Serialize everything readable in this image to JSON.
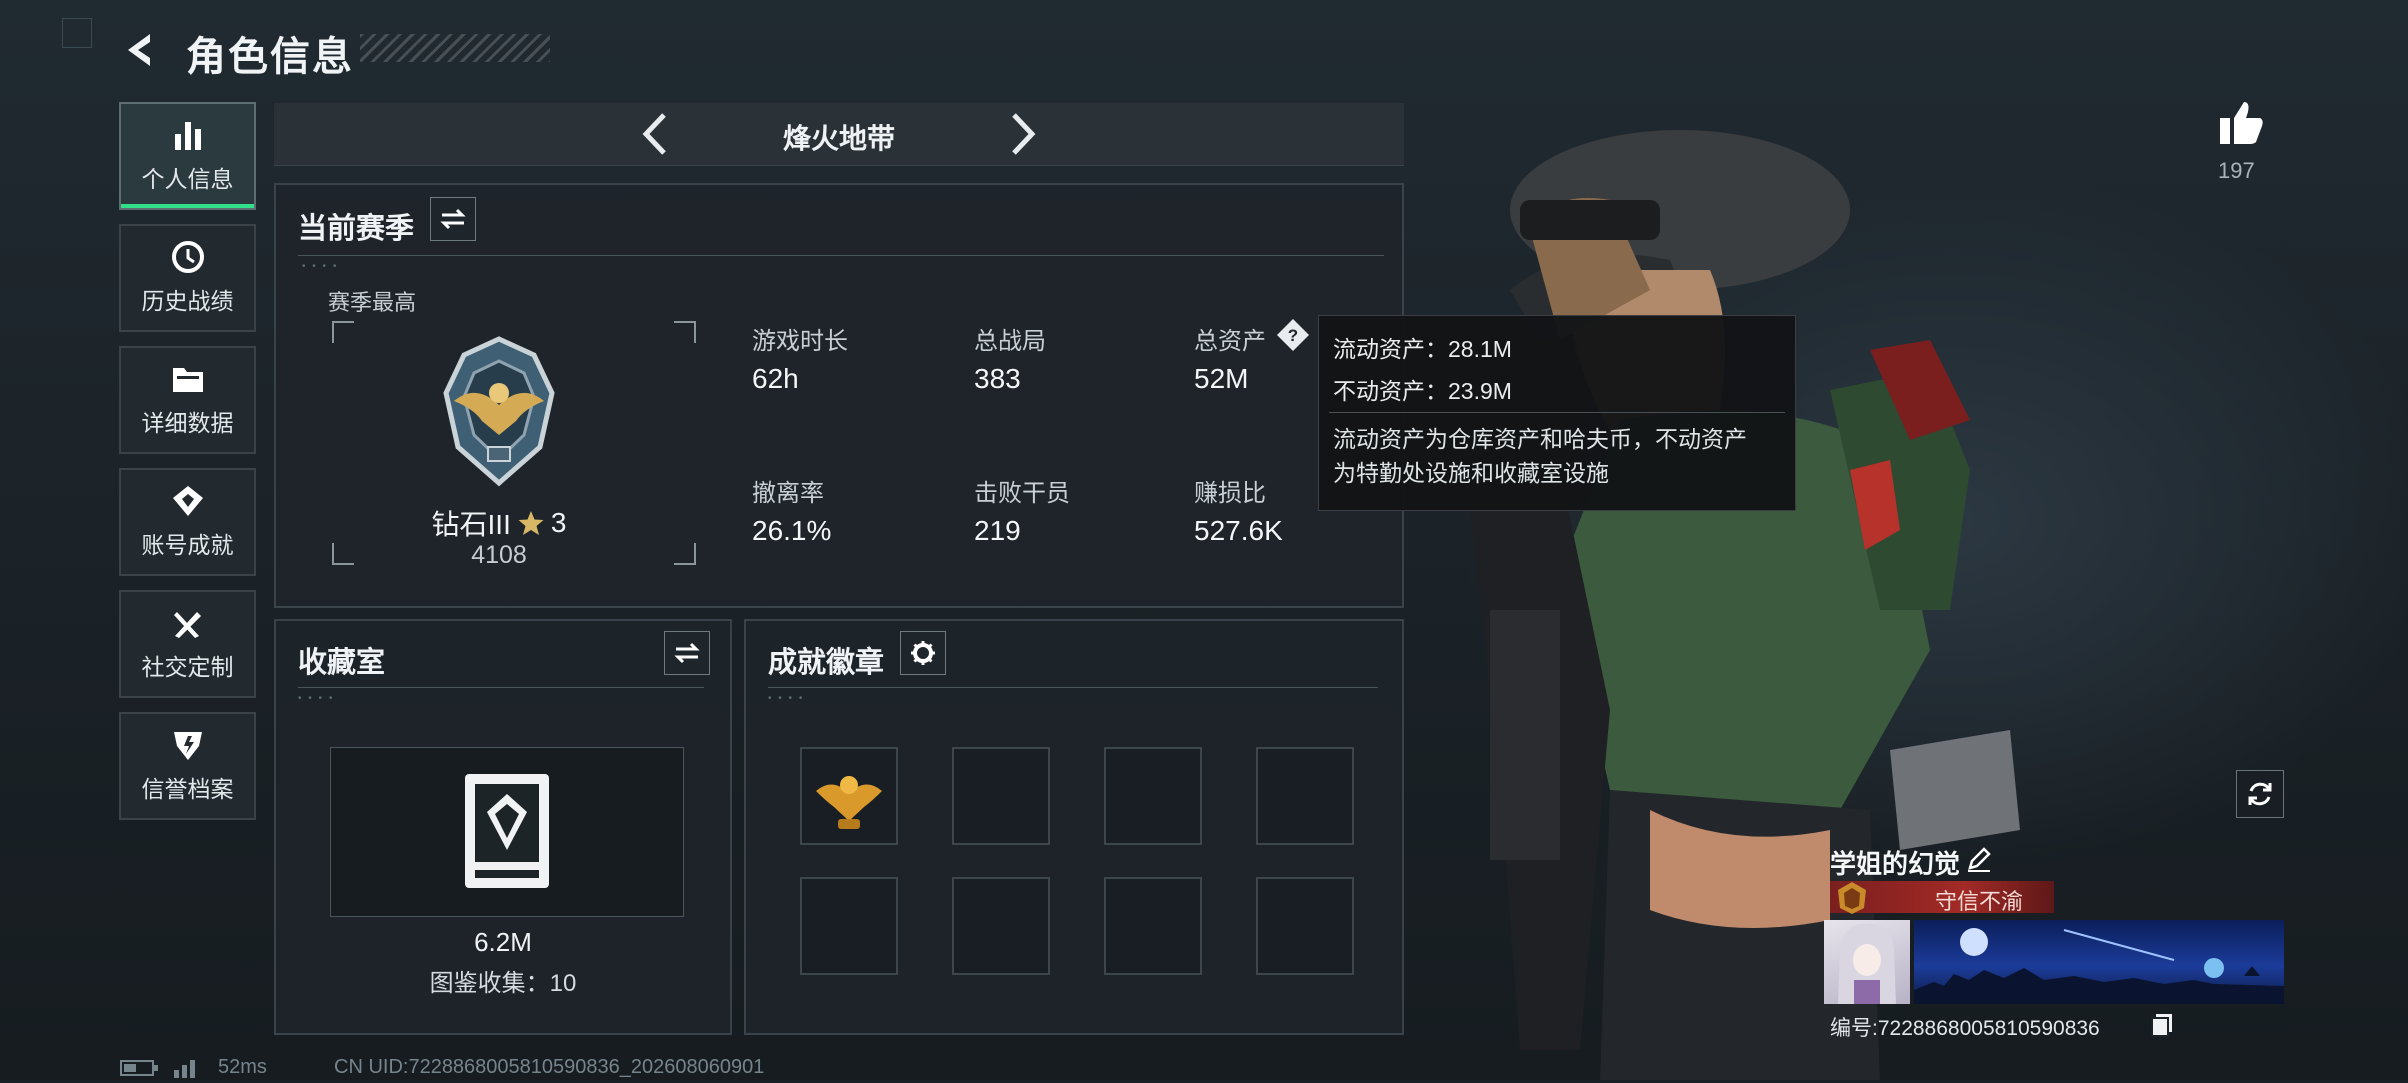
{
  "header": {
    "title": "角色信息"
  },
  "sidebar": {
    "items": [
      {
        "label": "个人信息",
        "icon": "bar-chart-icon",
        "active": true
      },
      {
        "label": "历史战绩",
        "icon": "clock-icon",
        "active": false
      },
      {
        "label": "详细数据",
        "icon": "folder-icon",
        "active": false
      },
      {
        "label": "账号成就",
        "icon": "achievement-icon",
        "active": false
      },
      {
        "label": "社交定制",
        "icon": "tools-icon",
        "active": false
      },
      {
        "label": "信誉档案",
        "icon": "shield-icon",
        "active": false
      }
    ]
  },
  "mode_nav": {
    "title": "烽火地带"
  },
  "season": {
    "title": "当前赛季",
    "best_label": "赛季最高",
    "rank_name": "钻石III",
    "rank_stars": "3",
    "rank_points": "4108",
    "stats": [
      {
        "label": "游戏时长",
        "value": "62h"
      },
      {
        "label": "总战局",
        "value": "383"
      },
      {
        "label": "总资产",
        "value": "52M"
      },
      {
        "label": "撤离率",
        "value": "26.1%"
      },
      {
        "label": "击败干员",
        "value": "219"
      },
      {
        "label": "赚损比",
        "value": "527.6K"
      }
    ]
  },
  "tooltip": {
    "liquid": "流动资产：28.1M",
    "fixed": "不动资产：23.9M",
    "desc_line1": "流动资产为仓库资产和哈夫币，不动资产",
    "desc_line2": "为特勤处设施和收藏室设施"
  },
  "collection": {
    "title": "收藏室",
    "value": "6.2M",
    "count_label": "图鉴收集：10"
  },
  "badges": {
    "title": "成就徽章"
  },
  "profile": {
    "likes": "197",
    "name": "学姐的幻觉",
    "honor": "守信不渝",
    "id_label": "编号:7228868005810590836"
  },
  "footer": {
    "ping": "52ms",
    "uid": "CN UID:7228868005810590836_202608060901"
  },
  "colors": {
    "accent_green": "#33e08a",
    "honor_red": "#a32a26",
    "panel_border": "#3a4349"
  }
}
